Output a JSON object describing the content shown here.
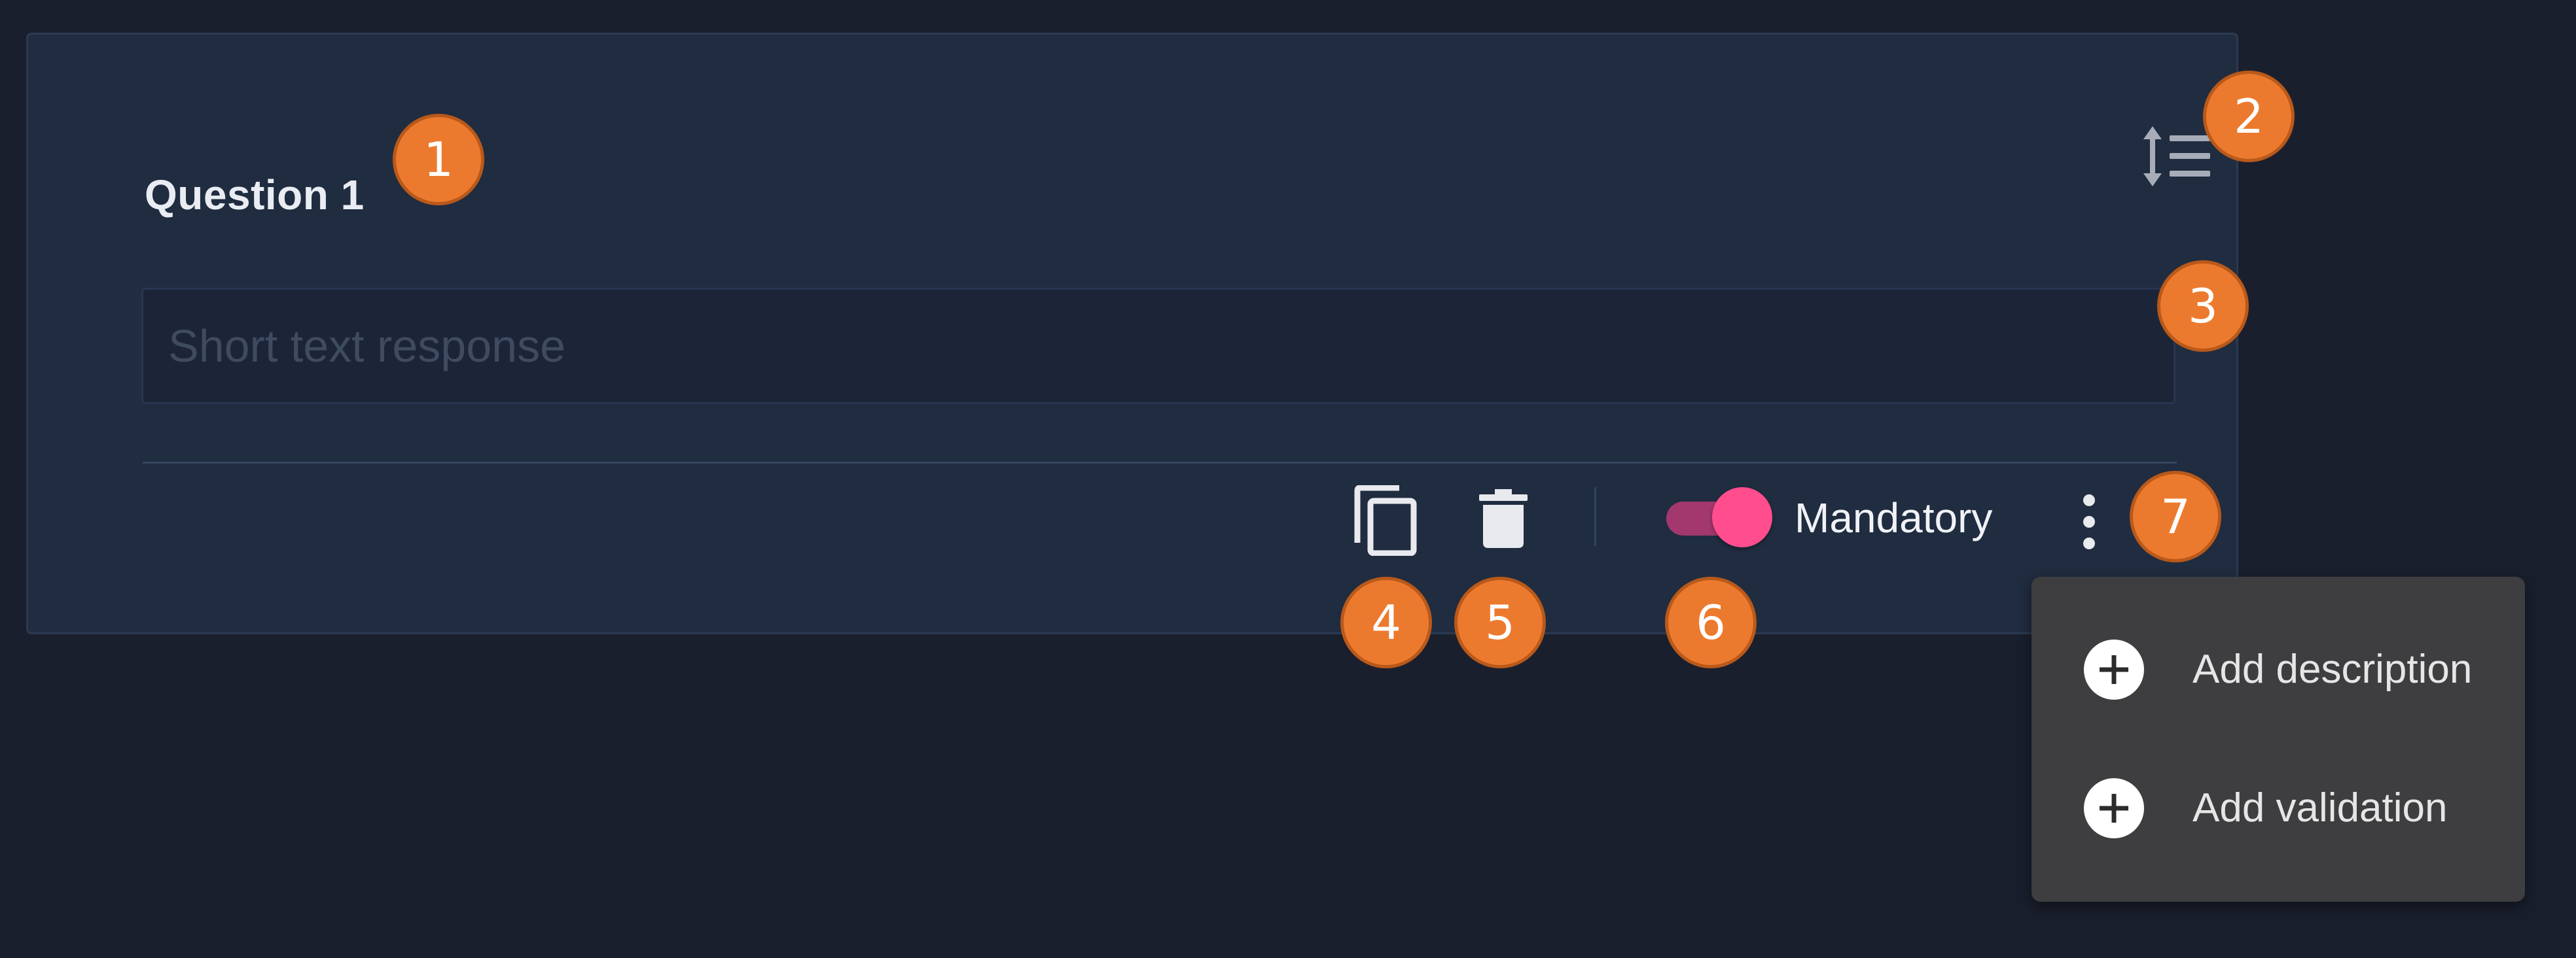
{
  "question": {
    "title": "Question 1",
    "answer_placeholder": "Short text response",
    "answer_value": ""
  },
  "toolbar": {
    "mandatory_label": "Mandatory",
    "mandatory_on": true
  },
  "menu": {
    "items": [
      {
        "label": "Add description",
        "icon": "plus-circle-icon"
      },
      {
        "label": "Add validation",
        "icon": "plus-circle-icon"
      }
    ]
  },
  "callouts": [
    "1",
    "2",
    "3",
    "4",
    "5",
    "6",
    "7"
  ],
  "icons": {
    "reorder": "reorder-icon",
    "copy": "copy-icon",
    "delete": "trash-icon",
    "more": "more-vertical-icon"
  },
  "colors": {
    "background": "#1a1f2d",
    "card": "#202c40",
    "accent_toggle": "#ff4d8d",
    "callout": "#ec7a2e",
    "menu": "#3e3e40"
  }
}
